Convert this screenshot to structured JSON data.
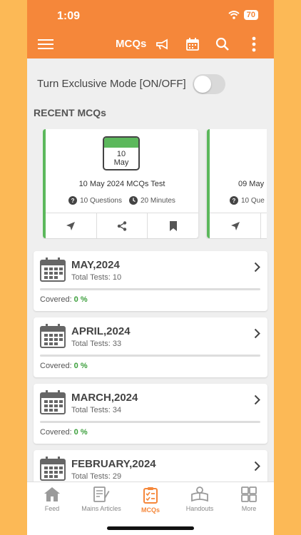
{
  "status_bar": {
    "time": "1:09",
    "battery": "70"
  },
  "toolbar": {
    "title": "MCQs"
  },
  "exclusive_mode": {
    "label": "Turn Exclusive Mode [ON/OFF]",
    "on": false
  },
  "recent": {
    "title": "RECENT MCQs",
    "cards": [
      {
        "day": "10",
        "month": "May",
        "title": "10 May 2024 MCQs Test",
        "questions": "10 Questions",
        "minutes": "20 Minutes"
      },
      {
        "title": "09 May",
        "questions": "10 Que"
      }
    ]
  },
  "months": [
    {
      "name": "MAY,2024",
      "total": "Total Tests: 10",
      "covered_label": "Covered:",
      "covered_value": "0 %",
      "progress": 0
    },
    {
      "name": "APRIL,2024",
      "total": "Total Tests: 33",
      "covered_label": "Covered:",
      "covered_value": "0 %",
      "progress": 0
    },
    {
      "name": "MARCH,2024",
      "total": "Total Tests: 34",
      "covered_label": "Covered:",
      "covered_value": "0 %",
      "progress": 0
    },
    {
      "name": "FEBRUARY,2024",
      "total": "Total Tests: 29"
    }
  ],
  "nav": [
    {
      "label": "Feed",
      "icon": "home-icon"
    },
    {
      "label": "Mains Articles",
      "icon": "article-icon"
    },
    {
      "label": "MCQs",
      "icon": "clipboard-icon",
      "active": true
    },
    {
      "label": "Handouts",
      "icon": "reader-icon"
    },
    {
      "label": "More",
      "icon": "grid-icon"
    }
  ],
  "colors": {
    "primary": "#f5873a",
    "accent_green": "#5cb85c",
    "background": "#fcb956"
  }
}
